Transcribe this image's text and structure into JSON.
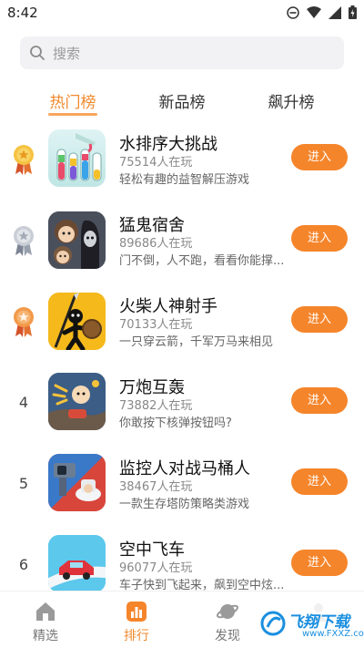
{
  "status_bar": {
    "time": "8:42"
  },
  "search": {
    "placeholder": "搜索"
  },
  "tabs": [
    {
      "label": "热门榜",
      "active": true
    },
    {
      "label": "新品榜",
      "active": false
    },
    {
      "label": "飙升榜",
      "active": false
    }
  ],
  "ranking": [
    {
      "rank": "1",
      "medal": "gold",
      "name": "水排序大挑战",
      "players": "75514人在玩",
      "desc": "轻松有趣的益智解压游戏",
      "button": "进入",
      "icon": "color-sort-icon"
    },
    {
      "rank": "2",
      "medal": "silver",
      "name": "猛鬼宿舍",
      "players": "89686人在玩",
      "desc": "门不倒，人不跑，看看你能撑...",
      "button": "进入",
      "icon": "ghost-dorm-icon"
    },
    {
      "rank": "3",
      "medal": "bronze",
      "name": "火柴人神射手",
      "players": "70133人在玩",
      "desc": "一只穿云箭，千军万马来相见",
      "button": "进入",
      "icon": "stickman-archer-icon"
    },
    {
      "rank": "4",
      "medal": "",
      "name": "万炮互轰",
      "players": "73882人在玩",
      "desc": "你敢按下核弹按钮吗?",
      "button": "进入",
      "icon": "cannon-battle-icon"
    },
    {
      "rank": "5",
      "medal": "",
      "name": "监控人对战马桶人",
      "players": "38467人在玩",
      "desc": "一款生存塔防策略类游戏",
      "button": "进入",
      "icon": "camera-vs-toilet-icon"
    },
    {
      "rank": "6",
      "medal": "",
      "name": "空中飞车",
      "players": "96077人在玩",
      "desc": "车子快到飞起来，飙到空中炫...",
      "button": "进入",
      "icon": "flying-car-icon"
    }
  ],
  "bottom_nav": [
    {
      "label": "精选",
      "icon": "home-icon",
      "active": false
    },
    {
      "label": "排行",
      "icon": "ranking-icon",
      "active": true
    },
    {
      "label": "发现",
      "icon": "planet-icon",
      "active": false
    },
    {
      "label": "",
      "icon": "profile-icon",
      "active": false
    }
  ],
  "watermark": {
    "title": "飞翔下载",
    "subtitle": "www.FXXZ.com"
  },
  "colors": {
    "accent": "#f5852b",
    "tab_active": "#f08a2e"
  }
}
